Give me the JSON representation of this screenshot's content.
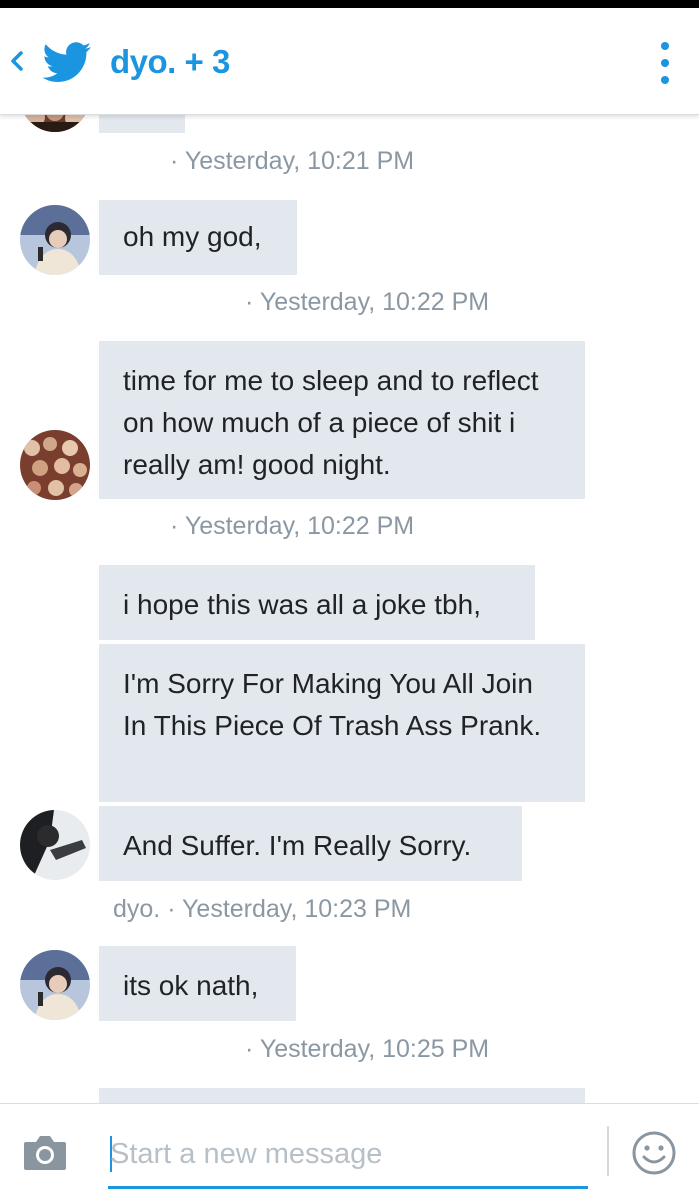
{
  "header": {
    "title": "dyo. + 3",
    "back_icon": "chevron-left-icon",
    "logo_icon": "twitter-bird-icon",
    "menu_icon": "overflow-menu-icon",
    "accent_color": "#1b95e0"
  },
  "messages": [
    {
      "timestamp": "· Yesterday, 10:21 PM"
    },
    {
      "text": "oh my god,",
      "timestamp": "· Yesterday, 10:22 PM"
    },
    {
      "text": "time for me to sleep and to reflect on how much of a piece of shit i really am! good night.",
      "timestamp": "· Yesterday, 10:22 PM"
    },
    {
      "text": "i hope this was all a joke tbh,"
    },
    {
      "text": "I'm Sorry For Making You All Join In This Piece Of Trash Ass Prank."
    },
    {
      "text": "And Suffer. I'm Really Sorry.",
      "sender": "dyo.",
      "timestamp": "· Yesterday, 10:23 PM"
    },
    {
      "text": "its ok nath,",
      "timestamp": "· Yesterday, 10:25 PM"
    }
  ],
  "composer": {
    "placeholder": "Start a new message",
    "camera_icon": "camera-icon",
    "emoji_icon": "smiley-icon"
  },
  "colors": {
    "bubble": "#e2e8ee",
    "meta_text": "#8b98a3"
  }
}
